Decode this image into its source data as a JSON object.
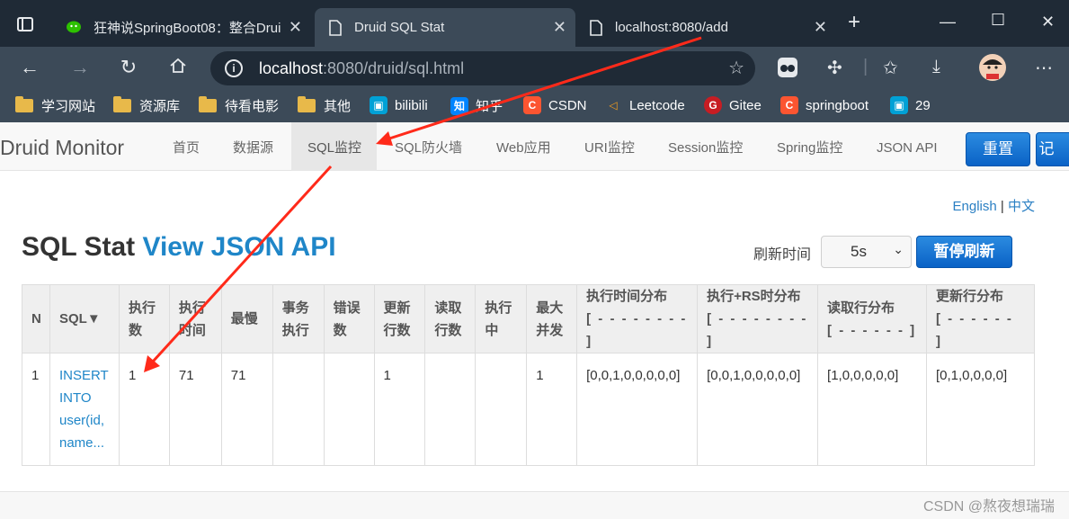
{
  "browser": {
    "tabs": [
      {
        "label": "狂神说SpringBoot08：整合Drui",
        "icon": "wechat-icon"
      },
      {
        "label": "Druid SQL Stat",
        "icon": "page-icon"
      },
      {
        "label": "localhost:8080/add",
        "icon": "page-icon"
      }
    ],
    "url_host": "localhost",
    "url_rest": ":8080/druid/sql.html",
    "bookmarks": [
      "学习网站",
      "资源库",
      "待看电影",
      "其他",
      "bilibili",
      "知乎",
      "CSDN",
      "Leetcode",
      "Gitee",
      "springboot",
      "29"
    ]
  },
  "nav": {
    "brand": "Druid Monitor",
    "items": [
      "首页",
      "数据源",
      "SQL监控",
      "SQL防火墙",
      "Web应用",
      "URI监控",
      "Session监控",
      "Spring监控",
      "JSON API"
    ],
    "reset": "重置",
    "cut_button": "记"
  },
  "lang": {
    "english": "English",
    "sep": "|",
    "chinese": "中文"
  },
  "heading": {
    "title": "SQL Stat",
    "link": "View JSON API"
  },
  "refresh": {
    "label": "刷新时间",
    "value": "5s",
    "pause": "暂停刷新"
  },
  "table": {
    "headers": {
      "n": "N",
      "sql": "SQL▼",
      "exec1": "执行",
      "exec2": "数",
      "time1": "执行",
      "time2": "时间",
      "slowest": "最慢",
      "tx1": "事务",
      "tx2": "执行",
      "err1": "错误",
      "err2": "数",
      "upd1": "更新",
      "upd2": "行数",
      "read1": "读取",
      "read2": "行数",
      "run1": "执行",
      "run2": "中",
      "conc1": "最大",
      "conc2": "并发",
      "dist1": "执行时间分布",
      "dist2": "[ - - - - - - - - ]",
      "rs1": "执行+RS时分布",
      "rs2": "[ - - - - - - - - ]",
      "rd1": "读取行分布",
      "rd2": "[ - - - - - - ]",
      "ud1": "更新行分布",
      "ud2": "[ - - - - - - ]"
    },
    "row": {
      "n": "1",
      "sql_l1": "INSERT",
      "sql_l2": "INTO",
      "sql_l3": "user(id,",
      "sql_l4": "name...",
      "exec": "1",
      "time": "71",
      "slowest": "71",
      "tx": "",
      "err": "",
      "upd": "1",
      "read": "",
      "run": "",
      "conc": "1",
      "dist": "[0,0,1,0,0,0,0,0]",
      "rs": "[0,0,1,0,0,0,0,0]",
      "rd": "[1,0,0,0,0,0]",
      "ud": "[0,1,0,0,0,0]"
    }
  },
  "watermark": "CSDN @熬夜想瑞瑞",
  "colors": {
    "annotation_arrow": "#ff2a1a",
    "accent_blue": "#1f86c8",
    "chrome_dark": "#1f2a36",
    "chrome_mid": "#3c4a58"
  }
}
